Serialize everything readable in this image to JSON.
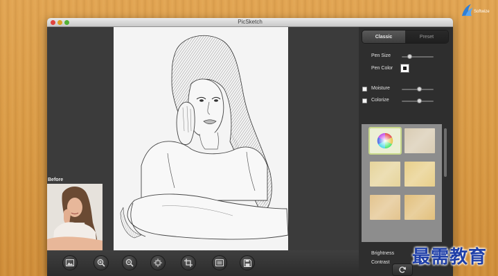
{
  "window": {
    "title": "PicSketch"
  },
  "before": {
    "label": "Before"
  },
  "panel": {
    "tabs": [
      {
        "label": "Classic",
        "active": true
      },
      {
        "label": "Preset",
        "active": false
      }
    ],
    "pen_size": {
      "label": "Pen Size",
      "value": 0.25
    },
    "pen_color": {
      "label": "Pen Color",
      "value": "#1a1a1a"
    },
    "moisture": {
      "label": "Moisture",
      "checked": false,
      "value": 0.55
    },
    "colorize": {
      "label": "Colorize",
      "checked": false,
      "value": 0.55
    },
    "brightness": {
      "label": "Brightness"
    },
    "contrast": {
      "label": "Contrast"
    },
    "paper_swatches": [
      {
        "name": "color-wheel",
        "color": "#ecefd5",
        "selected": true
      },
      {
        "name": "paper-1",
        "color": "#d9ccb3"
      },
      {
        "name": "paper-2",
        "color": "#e6d49b"
      },
      {
        "name": "paper-3",
        "color": "#e8cf8a"
      },
      {
        "name": "paper-4",
        "color": "#e3c48e"
      },
      {
        "name": "paper-5",
        "color": "#e2c07d"
      }
    ]
  },
  "toolbar": {
    "tools": [
      {
        "name": "open-image-button",
        "icon": "image-icon"
      },
      {
        "name": "zoom-in-button",
        "icon": "zoom-in-icon"
      },
      {
        "name": "zoom-out-button",
        "icon": "zoom-out-icon"
      },
      {
        "name": "fit-button",
        "icon": "fit-screen-icon"
      },
      {
        "name": "crop-button",
        "icon": "crop-icon"
      },
      {
        "name": "fullscreen-button",
        "icon": "fullscreen-icon"
      },
      {
        "name": "save-button",
        "icon": "save-icon"
      }
    ]
  },
  "watermark": {
    "text": "最需教育"
  },
  "colors": {
    "accent_selected": "#c8d98a",
    "panel_bg": "#2e2e2e",
    "workspace_bg": "#3b3b3b"
  }
}
